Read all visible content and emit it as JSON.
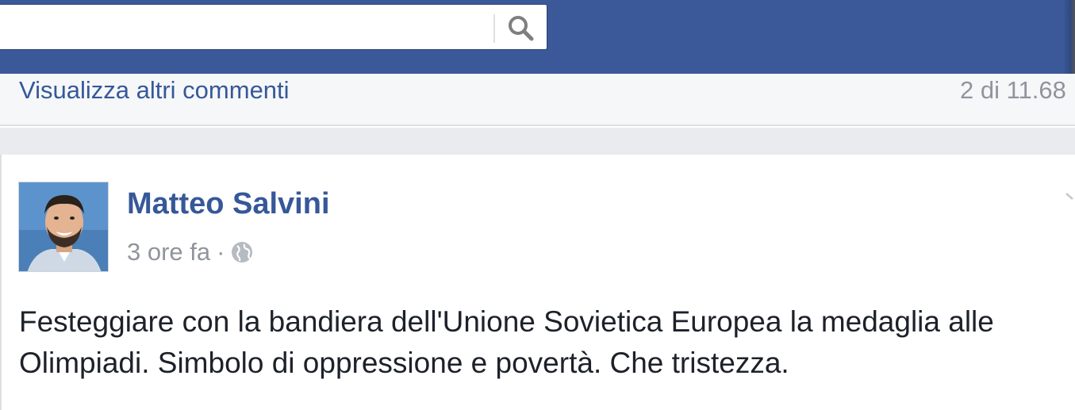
{
  "header": {
    "search": {
      "value": "",
      "placeholder": "",
      "button_icon": "search-icon"
    },
    "brand_color": "#3b5998"
  },
  "comments_bar": {
    "more_comments_label": "Visualizza altri commenti",
    "count_text": "2 di 11.68"
  },
  "post": {
    "author": "Matteo Salvini",
    "timestamp": "3 ore fa",
    "separator": "·",
    "privacy_icon": "globe-icon",
    "text_line_1": "Festeggiare con la bandiera dell'Unione Sovietica Europea la medaglia alle",
    "text_line_2": "Olimpiadi. Simbolo di oppressione e povertà. Che tristezza."
  },
  "colors": {
    "link": "#365899",
    "secondary_text": "#90949c",
    "body_text": "#1d2129",
    "background": "#e9ebee"
  }
}
